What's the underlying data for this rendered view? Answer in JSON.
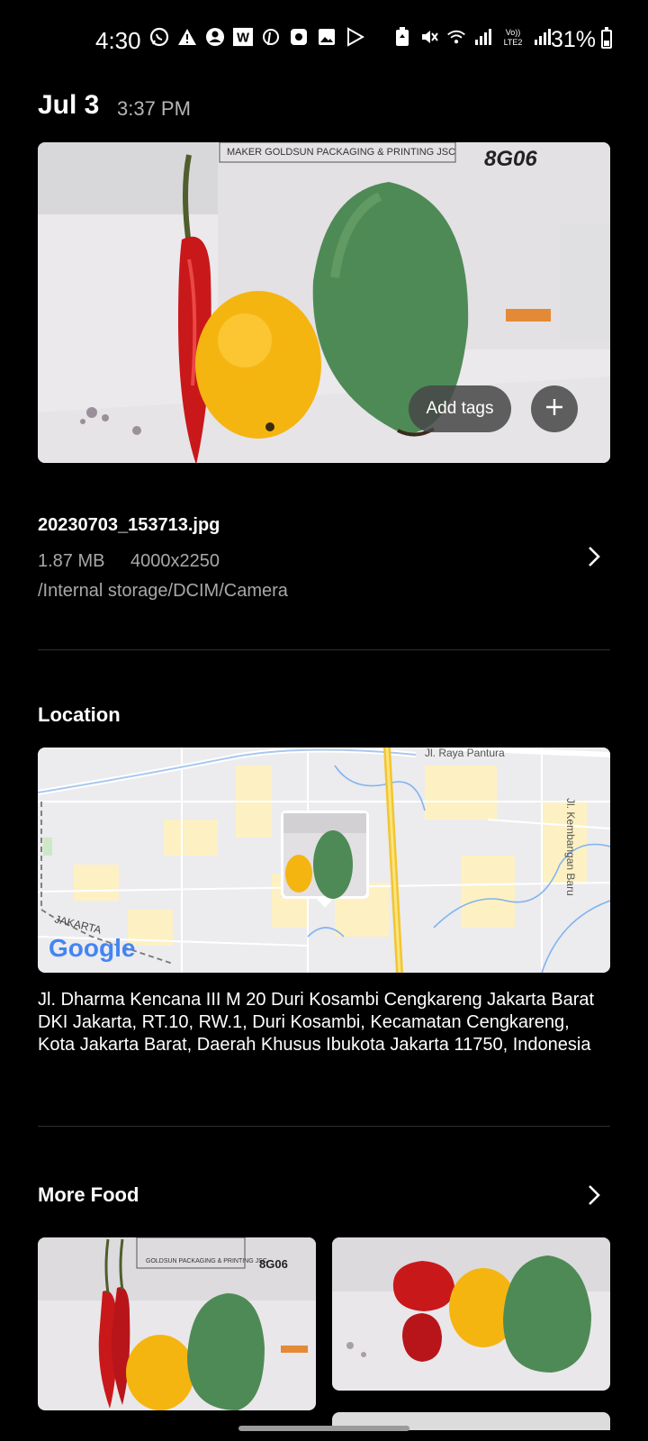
{
  "status_bar": {
    "time": "4:30",
    "battery_percent": "31%",
    "left_icons": [
      "whatsapp-icon",
      "alert-icon",
      "account-icon",
      "w-app-icon",
      "pinterest-icon",
      "camera-app-icon",
      "gallery-icon",
      "play-store-icon"
    ],
    "right_icons": [
      "battery-saver-icon",
      "mute-icon",
      "wifi-icon",
      "signal-icon",
      "volte-icon",
      "signal-2-icon"
    ],
    "volte_label": "Vo))\nLTE2"
  },
  "header": {
    "date": "Jul 3",
    "time": "3:37 PM"
  },
  "photo": {
    "box_label": "MAKER  GOLDSUN PACKAGING & PRINTING JSC",
    "box_code": "8G06",
    "add_tags_label": "Add tags"
  },
  "file_info": {
    "name": "20230703_153713.jpg",
    "size": "1.87 MB",
    "resolution": "4000x2250",
    "path": "/Internal storage/DCIM/Camera"
  },
  "location": {
    "title": "Location",
    "map_labels": {
      "road_top": "Jl. Raya Pantura",
      "road_right": "Jl. Kembangan Baru",
      "city": "JAKARTA",
      "brand": "Google"
    },
    "address": "Jl. Dharma Kencana III M 20 Duri Kosambi Cengkareng Jakarta Barat DKI Jakarta, RT.10, RW.1, Duri Kosambi, Kecamatan Cengkareng, Kota Jakarta Barat, Daerah Khusus Ibukota Jakarta 11750, Indonesia"
  },
  "more": {
    "title": "More Food",
    "thumb1_box_label": "GOLDSUN PACKAGING & PRINTING JSC",
    "thumb1_box_code": "8G06"
  },
  "colors": {
    "background": "#000000",
    "secondary_text": "#a8a8a8",
    "chip_bg": "#464646"
  }
}
